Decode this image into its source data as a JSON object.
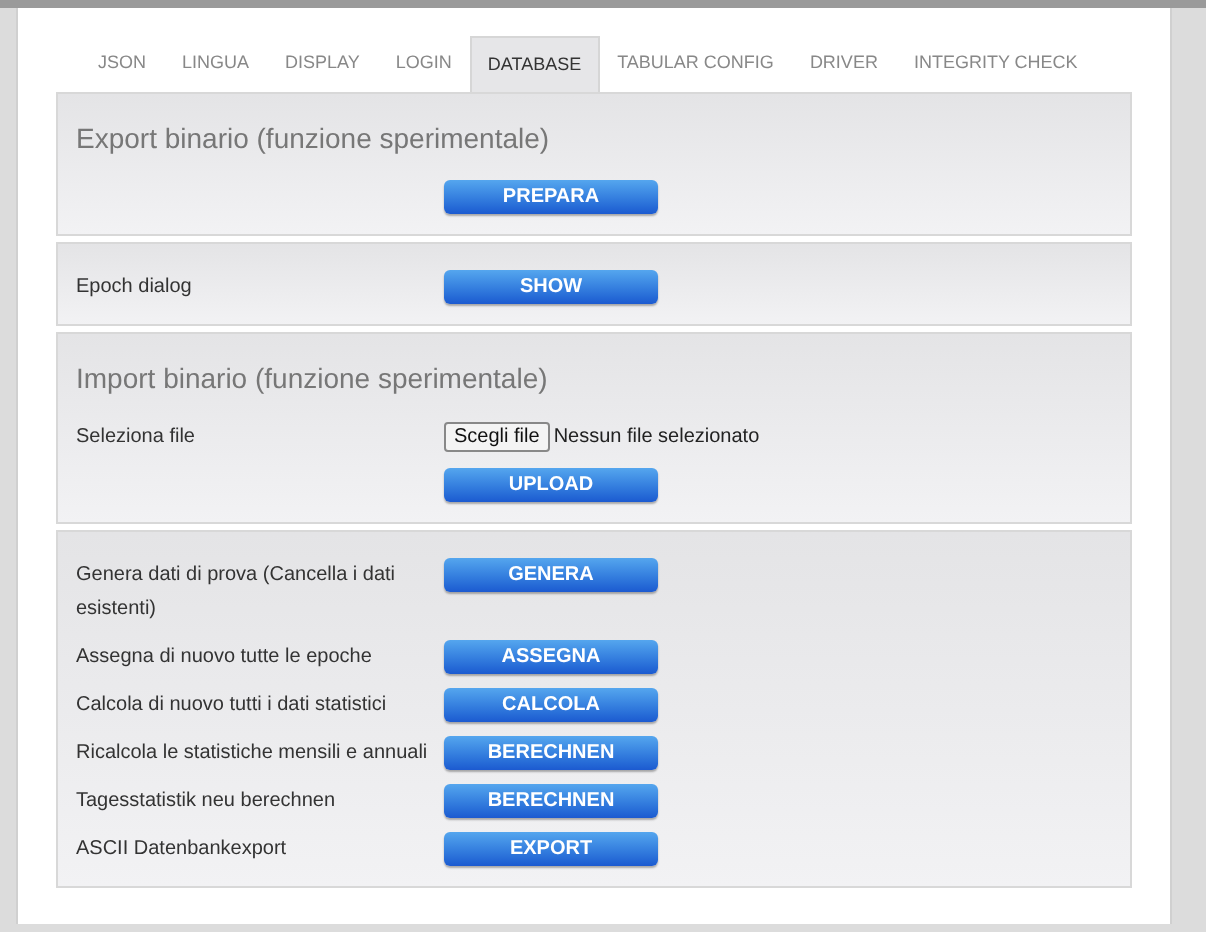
{
  "tabs": [
    {
      "label": "JSON",
      "selected": false
    },
    {
      "label": "LINGUA",
      "selected": false
    },
    {
      "label": "DISPLAY",
      "selected": false
    },
    {
      "label": "LOGIN",
      "selected": false
    },
    {
      "label": "DATABASE",
      "selected": true
    },
    {
      "label": "TABULAR CONFIG",
      "selected": false
    },
    {
      "label": "DRIVER",
      "selected": false
    },
    {
      "label": "INTEGRITY CHECK",
      "selected": false
    }
  ],
  "sections": [
    {
      "title": "Export binario (funzione sperimentale)",
      "rows": [
        {
          "kind": "button",
          "button": "PREPARA"
        }
      ]
    },
    {
      "rows": [
        {
          "kind": "button",
          "label": "Epoch dialog",
          "button": "SHOW"
        }
      ]
    },
    {
      "title": "Import binario (funzione sperimentale)",
      "rows": [
        {
          "kind": "file",
          "label": "Seleziona file",
          "file_button": "Scegli file",
          "file_status": "Nessun file selezionato"
        },
        {
          "kind": "button",
          "button": "UPLOAD"
        }
      ]
    },
    {
      "rows": [
        {
          "kind": "button",
          "label": "Genera dati di prova (Cancella i dati esistenti)",
          "button": "GENERA"
        },
        {
          "kind": "button",
          "label": "Assegna di nuovo tutte le epoche",
          "button": "ASSEGNA"
        },
        {
          "kind": "button",
          "label": "Calcola di nuovo tutti i dati statistici",
          "button": "CALCOLA"
        },
        {
          "kind": "button",
          "label": "Ricalcola le statistiche mensili e annuali",
          "button": "BERECHNEN"
        },
        {
          "kind": "button",
          "label": "Tagesstatistik neu berechnen",
          "button": "BERECHNEN"
        },
        {
          "kind": "button",
          "label": "ASCII Datenbankexport",
          "button": "EXPORT"
        }
      ]
    }
  ]
}
